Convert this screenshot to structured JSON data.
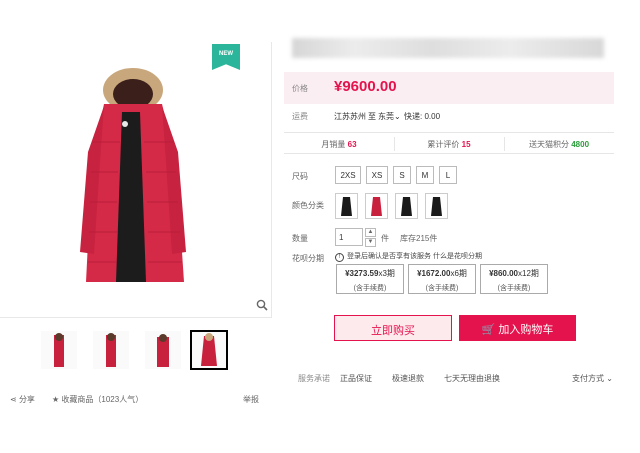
{
  "gallery": {
    "badge": "NEW",
    "share_label": "分享",
    "favorite_label": "收藏商品（1023人气）",
    "report_label": "举报"
  },
  "product": {
    "price_label": "价格",
    "price": "¥9600.00",
    "shipping_label": "运费",
    "ship_from": "江苏苏州",
    "ship_to_prefix": "至",
    "ship_to": "东莞",
    "ship_fee": "快递: 0.00",
    "stats": {
      "monthly_sales_label": "月销量",
      "monthly_sales": "63",
      "reviews_label": "累计评价",
      "reviews": "15",
      "points_label": "送天猫积分",
      "points": "4800"
    },
    "size_label": "尺码",
    "sizes": [
      "2XS",
      "XS",
      "S",
      "M",
      "L"
    ],
    "color_label": "颜色分类",
    "colors": [
      "#1a1a1a",
      "#c8213e",
      "#1a1a1a",
      "#1a1a1a"
    ],
    "qty_label": "数量",
    "qty_value": "1",
    "qty_unit": "件",
    "stock": "库存215件",
    "huabei_label": "花呗分期",
    "huabei_note": "登录后确认是否享有该服务 什么是花呗分期",
    "installments": [
      {
        "amount": "¥3273.59",
        "periods": "x3期",
        "fee": "(含手续费)"
      },
      {
        "amount": "¥1672.00",
        "periods": "x6期",
        "fee": "(含手续费)"
      },
      {
        "amount": "¥860.00",
        "periods": "x12期",
        "fee": "(含手续费)"
      }
    ],
    "buy_now": "立即购买",
    "add_to_cart": "加入购物车",
    "service_label": "服务承诺",
    "services": [
      "正品保证",
      "极速退款",
      "七天无理由退换"
    ],
    "payment_label": "支付方式"
  },
  "colors": {
    "accent": "#e5134d",
    "badge": "#2bb59a",
    "price_bg": "#fbeef3",
    "points": "#2a9d3a"
  }
}
